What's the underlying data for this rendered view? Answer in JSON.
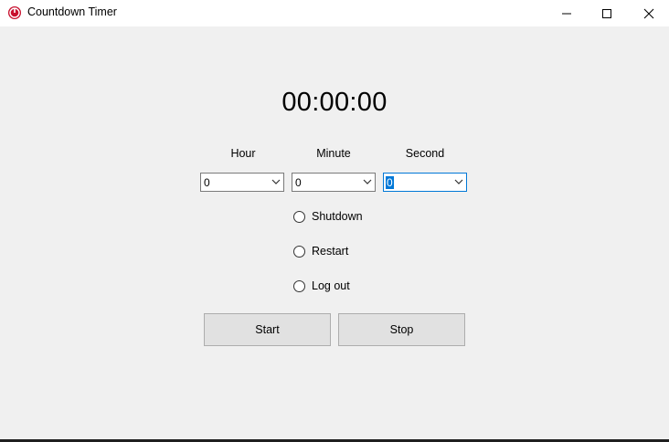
{
  "window": {
    "title": "Countdown Timer",
    "app_icon": "power-icon",
    "controls": [
      "minimize-icon",
      "maximize-icon",
      "close-icon"
    ]
  },
  "timer": {
    "display": "00:00:00"
  },
  "time_fields": [
    {
      "label": "Hour",
      "value": "0"
    },
    {
      "label": "Minute",
      "value": "0"
    },
    {
      "label": "Second",
      "value": "0"
    }
  ],
  "actions": [
    {
      "label": "Shutdown",
      "selected": false
    },
    {
      "label": "Restart",
      "selected": false
    },
    {
      "label": "Log out",
      "selected": false
    }
  ],
  "buttons": {
    "start": "Start",
    "stop": "Stop"
  },
  "colors": {
    "accent": "#0078d7",
    "background": "#f0f0f0",
    "button": "#e1e1e1",
    "icon": "#c8102e"
  }
}
